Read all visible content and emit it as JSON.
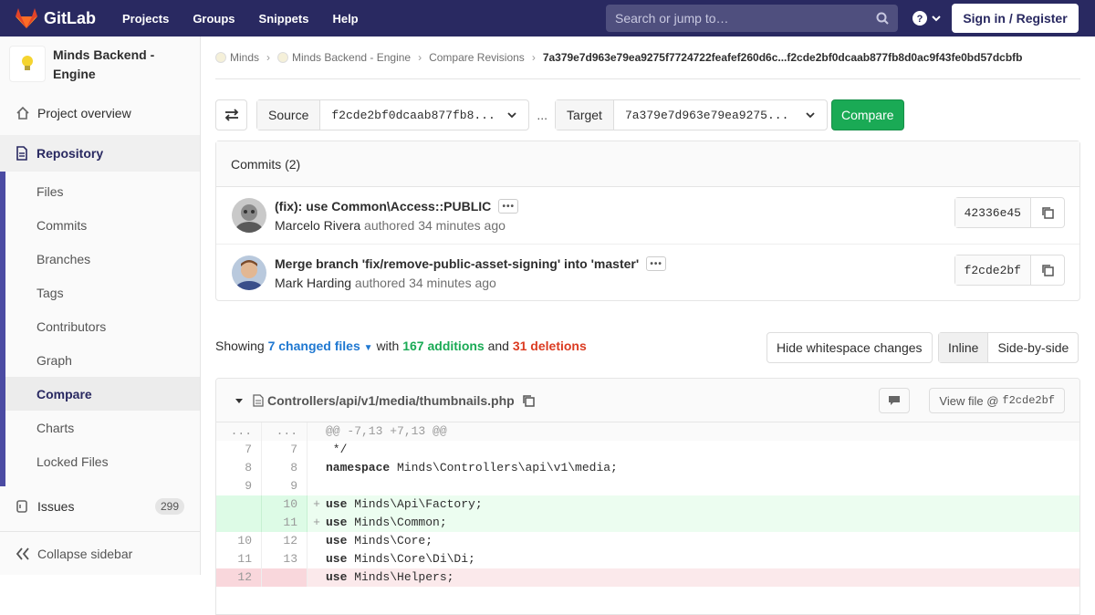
{
  "topbar": {
    "brand": "GitLab",
    "nav": [
      "Projects",
      "Groups",
      "Snippets",
      "Help"
    ],
    "search_placeholder": "Search or jump to…",
    "signin": "Sign in / Register"
  },
  "sidebar": {
    "project_name": "Minds Backend - Engine",
    "overview": "Project overview",
    "repository": "Repository",
    "subitems": [
      "Files",
      "Commits",
      "Branches",
      "Tags",
      "Contributors",
      "Graph",
      "Compare",
      "Charts",
      "Locked Files"
    ],
    "active_subitem": "Compare",
    "issues": "Issues",
    "issues_count": "299",
    "collapse": "Collapse sidebar"
  },
  "breadcrumb": {
    "items": [
      "Minds",
      "Minds Backend - Engine",
      "Compare Revisions"
    ],
    "current": "7a379e7d963e79ea9275f7724722feafef260d6c...f2cde2bf0dcaab877fb8d0ac9f43fe0bd57dcbfb"
  },
  "compare": {
    "source_label": "Source",
    "source_value": "f2cde2bf0dcaab877fb8...",
    "separator": "...",
    "target_label": "Target",
    "target_value": "7a379e7d963e79ea9275...",
    "button": "Compare"
  },
  "commits": {
    "header": "Commits (2)",
    "list": [
      {
        "title": "(fix): use Common\\Access::PUBLIC",
        "author": "Marcelo Rivera",
        "meta": "authored 34 minutes ago",
        "sha": "42336e45"
      },
      {
        "title": "Merge branch 'fix/remove-public-asset-signing' into 'master'",
        "author": "Mark Harding",
        "meta": "authored 34 minutes ago",
        "sha": "f2cde2bf"
      }
    ]
  },
  "stats": {
    "showing": "Showing",
    "changed": "7 changed files",
    "with": "with",
    "additions": "167 additions",
    "and": "and",
    "deletions": "31 deletions"
  },
  "buttons": {
    "whitespace": "Hide whitespace changes",
    "inline": "Inline",
    "side": "Side-by-side"
  },
  "file": {
    "path": "Controllers/api/v1/media/thumbnails.php",
    "view_file": "View file @",
    "view_sha": "f2cde2bf",
    "lines": [
      {
        "type": "hunk",
        "old": "...",
        "new": "...",
        "sign": "",
        "kw": "",
        "text": "@@ -7,13 +7,13 @@"
      },
      {
        "type": "ctx",
        "old": "7",
        "new": "7",
        "sign": "",
        "kw": "",
        "text": " */"
      },
      {
        "type": "ctx",
        "old": "8",
        "new": "8",
        "sign": "",
        "kw": "namespace",
        "text": " Minds\\Controllers\\api\\v1\\media;"
      },
      {
        "type": "ctx",
        "old": "9",
        "new": "9",
        "sign": "",
        "kw": "",
        "text": ""
      },
      {
        "type": "add",
        "old": "",
        "new": "10",
        "sign": "+",
        "kw": "use",
        "text": " Minds\\Api\\Factory;"
      },
      {
        "type": "add",
        "old": "",
        "new": "11",
        "sign": "+",
        "kw": "use",
        "text": " Minds\\Common;"
      },
      {
        "type": "ctx",
        "old": "10",
        "new": "12",
        "sign": "",
        "kw": "use",
        "text": " Minds\\Core;"
      },
      {
        "type": "ctx",
        "old": "11",
        "new": "13",
        "sign": "",
        "kw": "use",
        "text": " Minds\\Core\\Di\\Di;"
      },
      {
        "type": "del",
        "old": "12",
        "new": "",
        "sign": "",
        "kw": "use",
        "text": " Minds\\Helpers;"
      }
    ]
  }
}
